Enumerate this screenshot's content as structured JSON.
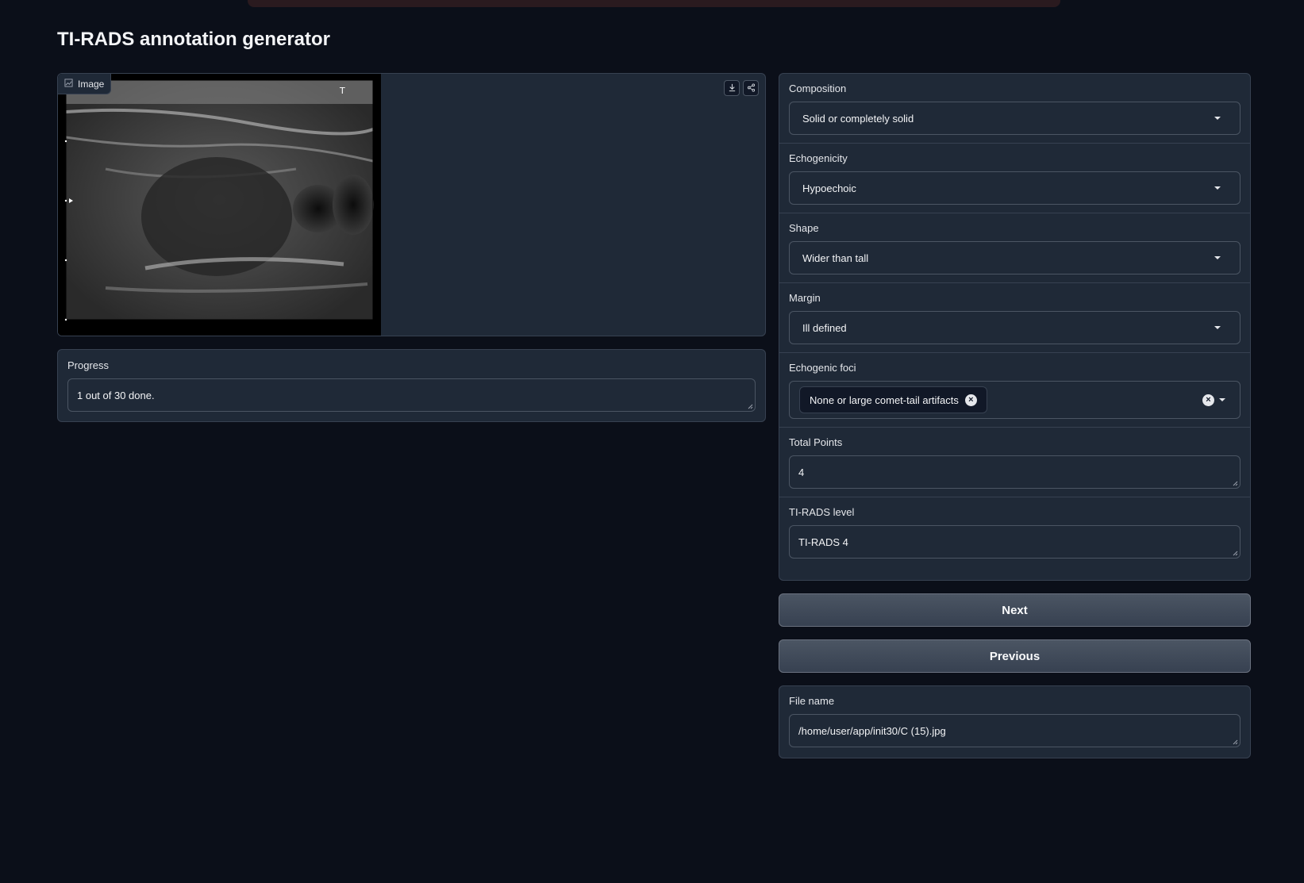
{
  "app": {
    "title": "TI-RADS annotation generator"
  },
  "image": {
    "label": "Image",
    "label_icon": "image-icon",
    "download_icon": "download-icon",
    "share_icon": "share-icon"
  },
  "progress": {
    "label": "Progress",
    "value": "1 out of 30 done."
  },
  "form": {
    "composition": {
      "label": "Composition",
      "value": "Solid or completely solid"
    },
    "echogenicity": {
      "label": "Echogenicity",
      "value": "Hypoechoic"
    },
    "shape": {
      "label": "Shape",
      "value": "Wider than tall"
    },
    "margin": {
      "label": "Margin",
      "value": "Ill defined"
    },
    "echogenic_foci": {
      "label": "Echogenic foci",
      "selected": [
        "None or large comet-tail artifacts"
      ]
    },
    "total_points": {
      "label": "Total Points",
      "value": "4"
    },
    "tirads_level": {
      "label": "TI-RADS level",
      "value": "TI-RADS 4"
    }
  },
  "buttons": {
    "next": "Next",
    "previous": "Previous"
  },
  "file": {
    "label": "File name",
    "value": "/home/user/app/init30/C (15).jpg"
  },
  "colors": {
    "background": "#0b0f19",
    "panel": "#1f2937",
    "border": "#374151",
    "button": "#4b5563"
  }
}
